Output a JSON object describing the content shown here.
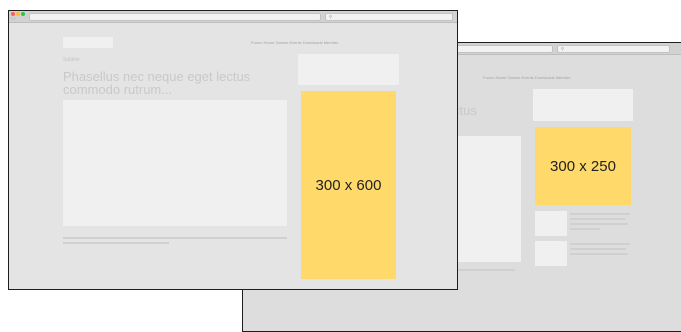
{
  "front": {
    "nav": "Forum Home Games Events Downloads Member",
    "eyebrow": "Subtitle",
    "headline": "Phasellus nec neque eget lectus commodo rutrum...",
    "ad_label": "300 x 600"
  },
  "back": {
    "nav": "Forum Home Games Events Downloads Member",
    "headline_fragment": "ctus",
    "ad_label": "300 x 250"
  },
  "colors": {
    "ad": "#ffd96a",
    "page_bg": "#e4e4e4",
    "placeholder": "#f0f0f0",
    "frame": "#1e1e1e"
  }
}
